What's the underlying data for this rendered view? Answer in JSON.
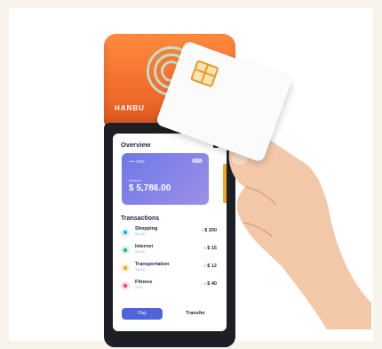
{
  "device": {
    "brand": "HANBU"
  },
  "app": {
    "title": "Overview",
    "card": {
      "number": "•••• 7890",
      "balance_label": "Balance",
      "balance": "$ 5,786.00"
    },
    "transactions_title": "Transactions",
    "transactions": [
      {
        "name": "Shopping",
        "sub": "08:120",
        "amount": "- $ 200",
        "color": "#27b3d6"
      },
      {
        "name": "Internet",
        "sub": "09:120",
        "amount": "- $ 15",
        "color": "#2ec06f"
      },
      {
        "name": "Transportation",
        "sub": "08:120",
        "amount": "- $ 12",
        "color": "#f5a623"
      },
      {
        "name": "Fitness",
        "sub": "11:20",
        "amount": "- $ 40",
        "color": "#e7507a"
      }
    ],
    "buttons": {
      "pay": "Pay",
      "transfer": "Transfer"
    }
  }
}
